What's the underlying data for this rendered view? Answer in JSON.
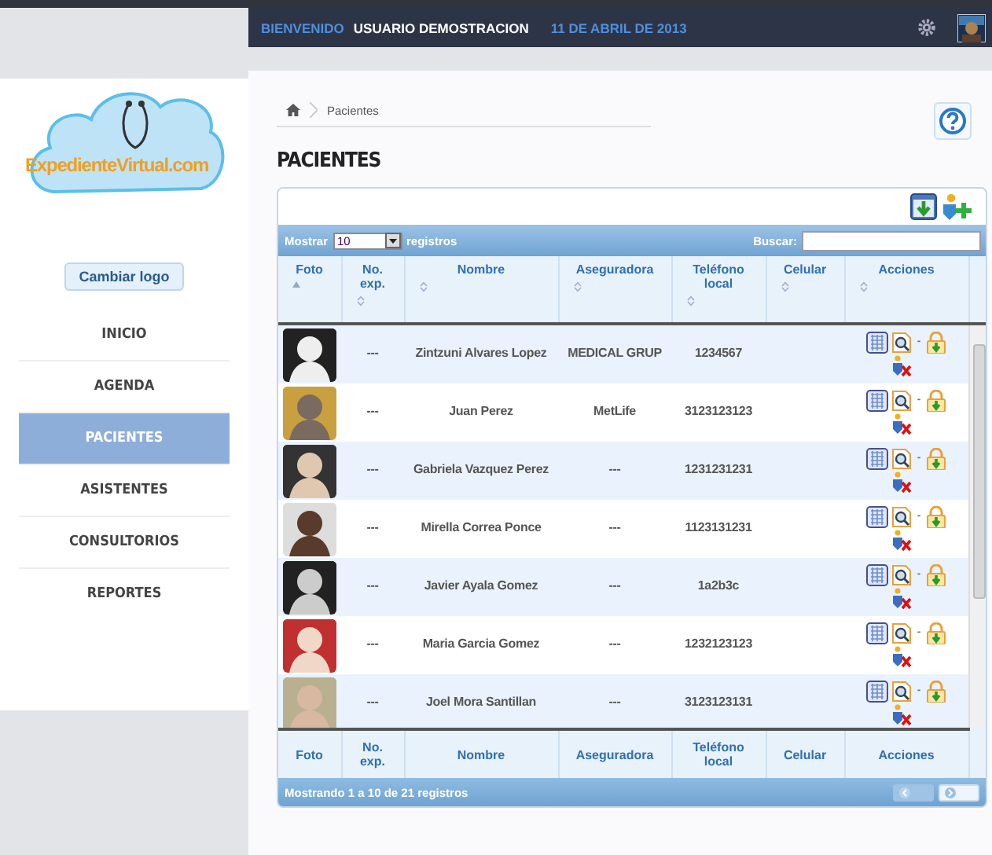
{
  "header": {
    "greeting": "BIENVENIDO",
    "user": "USUARIO DEMOSTRACION",
    "date": "11 DE ABRIL DE 2013"
  },
  "sidebar": {
    "logo_text": "ExpedienteVirtual.com",
    "change_logo_button": "Cambiar logo",
    "items": [
      {
        "label": "INICIO",
        "selected": false
      },
      {
        "label": "AGENDA",
        "selected": false
      },
      {
        "label": "PACIENTES",
        "selected": true
      },
      {
        "label": "ASISTENTES",
        "selected": false
      },
      {
        "label": "CONSULTORIOS",
        "selected": false
      },
      {
        "label": "REPORTES",
        "selected": false
      }
    ]
  },
  "breadcrumb": [
    "Pacientes"
  ],
  "page_title": "PACIENTES",
  "table": {
    "show_label": "Mostrar",
    "page_size": "10",
    "records_label": "registros",
    "search_label": "Buscar:",
    "columns": [
      {
        "label": "Foto",
        "sorted": true
      },
      {
        "label": "No. exp.",
        "sorted": false
      },
      {
        "label": "Nombre",
        "sorted": false
      },
      {
        "label": "Aseguradora",
        "sorted": false
      },
      {
        "label": "Teléfono local",
        "sorted": false
      },
      {
        "label": "Celular",
        "sorted": false
      },
      {
        "label": "Acciones",
        "sorted": false
      }
    ],
    "rows": [
      {
        "file_no": "---",
        "name": "Zintzuni Alvares Lopez",
        "insurer": "MEDICAL GRUP",
        "phone": "1234567",
        "separator": "-"
      },
      {
        "file_no": "---",
        "name": "Juan Perez",
        "insurer": "MetLife",
        "phone": "3123123123",
        "separator": "-"
      },
      {
        "file_no": "---",
        "name": "Gabriela Vazquez Perez",
        "insurer": "---",
        "phone": "1231231231",
        "separator": "-"
      },
      {
        "file_no": "---",
        "name": "Mirella Correa Ponce",
        "insurer": "---",
        "phone": "1123131231",
        "separator": "-"
      },
      {
        "file_no": "---",
        "name": "Javier Ayala Gomez",
        "insurer": "---",
        "phone": "1a2b3c",
        "separator": "-"
      },
      {
        "file_no": "---",
        "name": "Maria Garcia Gomez",
        "insurer": "---",
        "phone": "1232123123",
        "separator": "-"
      },
      {
        "file_no": "---",
        "name": "Joel Mora Santillan",
        "insurer": "---",
        "phone": "3123123131",
        "separator": "-"
      }
    ],
    "footer_columns": [
      "Foto",
      "No. exp.",
      "Nombre",
      "Aseguradora",
      "Teléfono local",
      "Celular",
      "Acciones"
    ],
    "info": "Mostrando 1 a 10 de 21 registros",
    "pager": [
      {
        "kind": "previous",
        "disabled": true
      },
      {
        "kind": "next",
        "disabled": false
      }
    ]
  }
}
